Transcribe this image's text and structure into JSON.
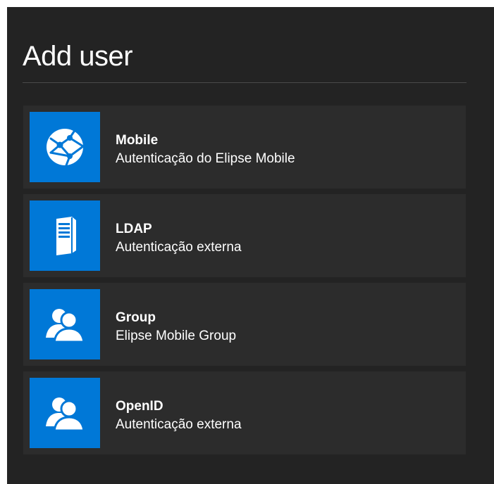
{
  "dialog": {
    "title": "Add user"
  },
  "options": [
    {
      "name": "Mobile",
      "description": "Autenticação do Elipse Mobile",
      "icon": "globe-network-icon"
    },
    {
      "name": "LDAP",
      "description": "Autenticação externa",
      "icon": "server-icon"
    },
    {
      "name": "Group",
      "description": "Elipse Mobile Group",
      "icon": "users-icon"
    },
    {
      "name": "OpenID",
      "description": "Autenticação externa",
      "icon": "users-icon"
    }
  ],
  "colors": {
    "background": "#232323",
    "item_background": "#2c2c2c",
    "accent": "#0078d7",
    "text": "#ffffff"
  }
}
